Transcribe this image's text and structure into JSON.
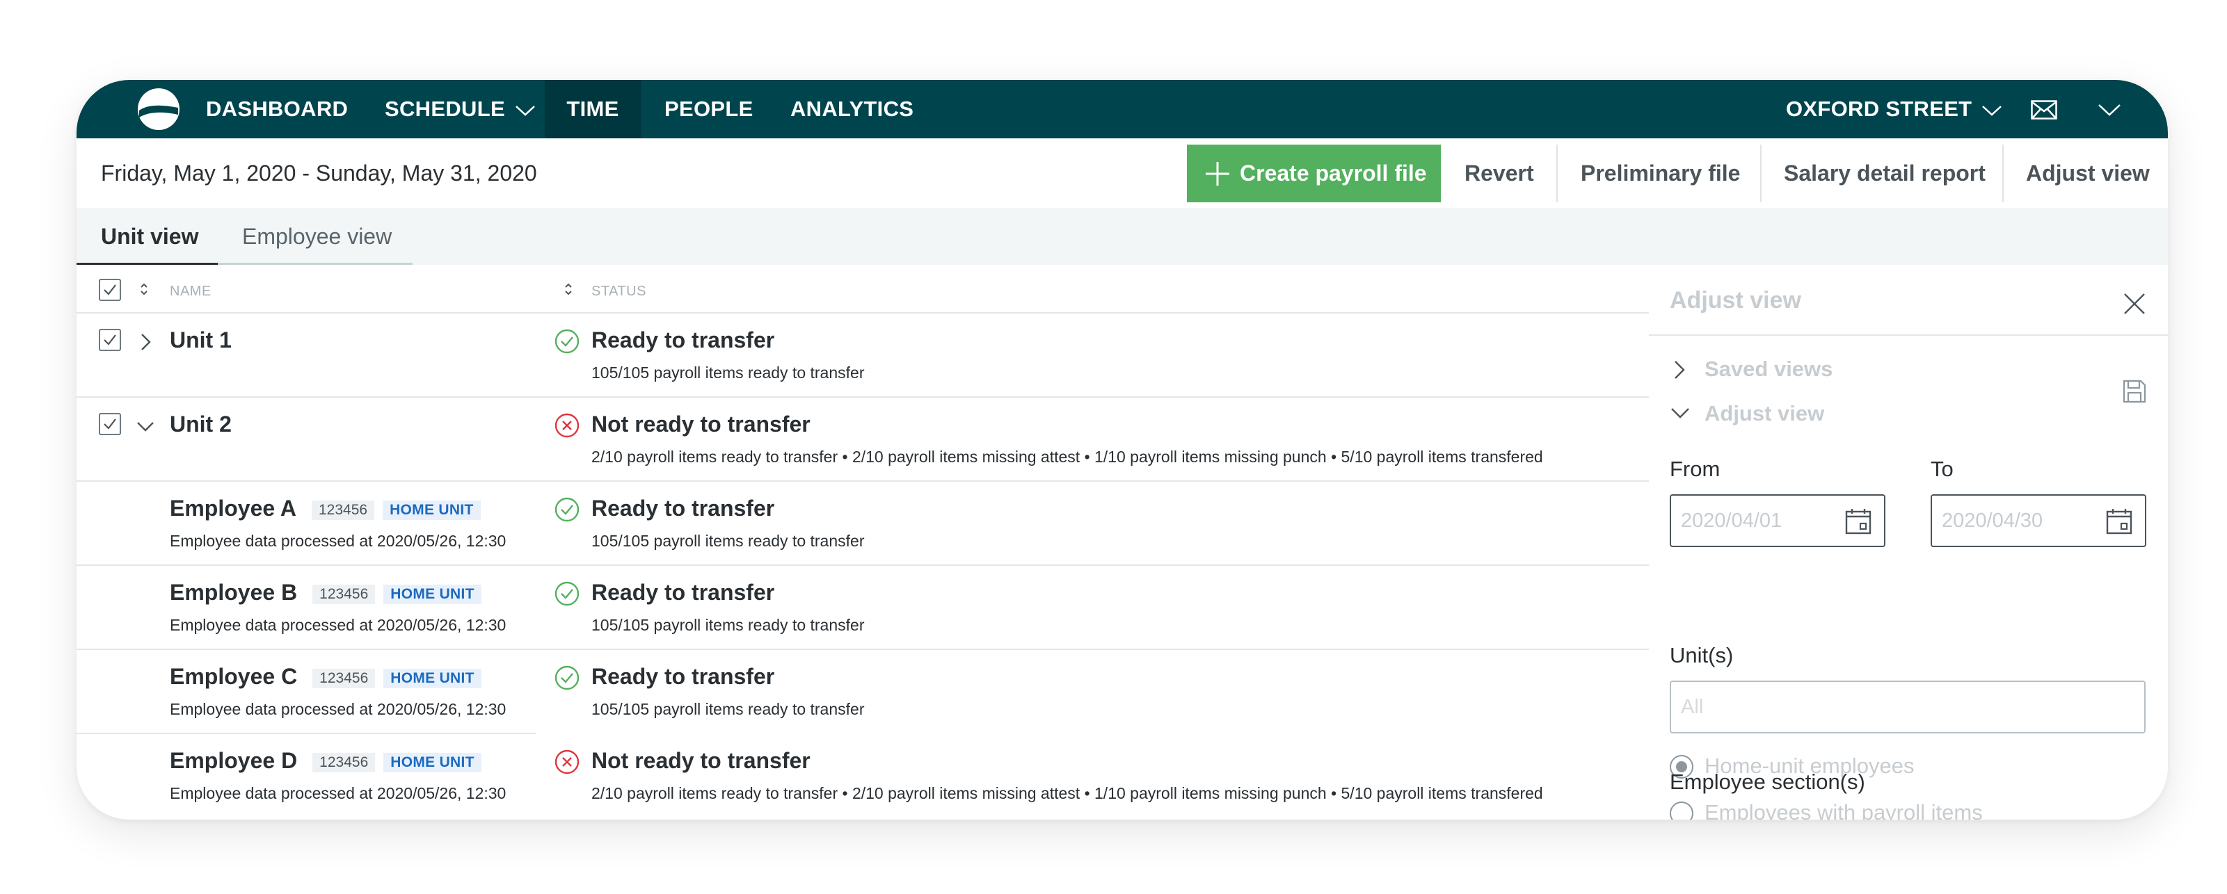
{
  "nav": {
    "items": [
      {
        "label": "DASHBOARD"
      },
      {
        "label": "SCHEDULE"
      },
      {
        "label": "TIME"
      },
      {
        "label": "PEOPLE"
      },
      {
        "label": "ANALYTICS"
      }
    ],
    "location": "OXFORD STREET",
    "active": "TIME",
    "bar_color": "#00444d"
  },
  "toolbar": {
    "date_range": "Friday, May 1, 2020 - Sunday, May 31, 2020",
    "create_label": "Create payroll file",
    "revert_label": "Revert",
    "preliminary_label": "Preliminary file",
    "salary_label": "Salary detail report",
    "adjust_label": "Adjust view",
    "primary_color": "#52b05e"
  },
  "tabs": [
    {
      "label": "Unit view",
      "active": true
    },
    {
      "label": "Employee view",
      "active": false
    }
  ],
  "table": {
    "headers": {
      "name": "NAME",
      "status": "STATUS"
    },
    "rows": [
      {
        "name": "Unit 1",
        "status": "Ready to transfer",
        "detail": "105/105 payroll items ready to transfer",
        "ok": true
      },
      {
        "name": "Unit 2",
        "status": "Not ready to transfer",
        "detail": "2/10 payroll items ready to transfer • 2/10 payroll items missing attest • 1/10 payroll items missing punch •  5/10 payroll items transfered",
        "ok": false
      },
      {
        "name": "Employee A",
        "id": "123456",
        "badge": "HOME UNIT",
        "sub": "Employee data processed at 2020/05/26, 12:30",
        "status": "Ready to transfer",
        "detail": "105/105 payroll items ready to transfer",
        "ok": true
      },
      {
        "name": "Employee B",
        "id": "123456",
        "badge": "HOME UNIT",
        "sub": "Employee data processed at 2020/05/26, 12:30",
        "status": "Ready to transfer",
        "detail": "105/105 payroll items ready to transfer",
        "ok": true
      },
      {
        "name": "Employee C",
        "id": "123456",
        "badge": "HOME UNIT",
        "sub": "Employee data processed at 2020/05/26, 12:30",
        "status": "Ready to transfer",
        "detail": "105/105 payroll items ready to transfer",
        "ok": true
      },
      {
        "name": "Employee D",
        "id": "123456",
        "badge": "HOME UNIT",
        "sub": "Employee data processed at 2020/05/26, 12:30",
        "status": "Not ready to transfer",
        "detail": "2/10 payroll items ready to transfer • 2/10 payroll items missing attest • 1/10 payroll items missing punch •  5/10 payroll items transfered",
        "ok": false
      }
    ],
    "ok_color": "#52b05e",
    "error_color": "#e0363c"
  },
  "panel": {
    "title": "Adjust view",
    "saved_views": "Saved views",
    "adjust_view": "Adjust view",
    "from_label": "From",
    "to_label": "To",
    "from_value": "2020/04/01",
    "to_value": "2020/04/30",
    "units_label": "Unit(s)",
    "units_placeholder": "All",
    "radio_home": "Home-unit employees",
    "radio_payroll": "Employees with payroll items",
    "sections_label": "Employee section(s)"
  }
}
